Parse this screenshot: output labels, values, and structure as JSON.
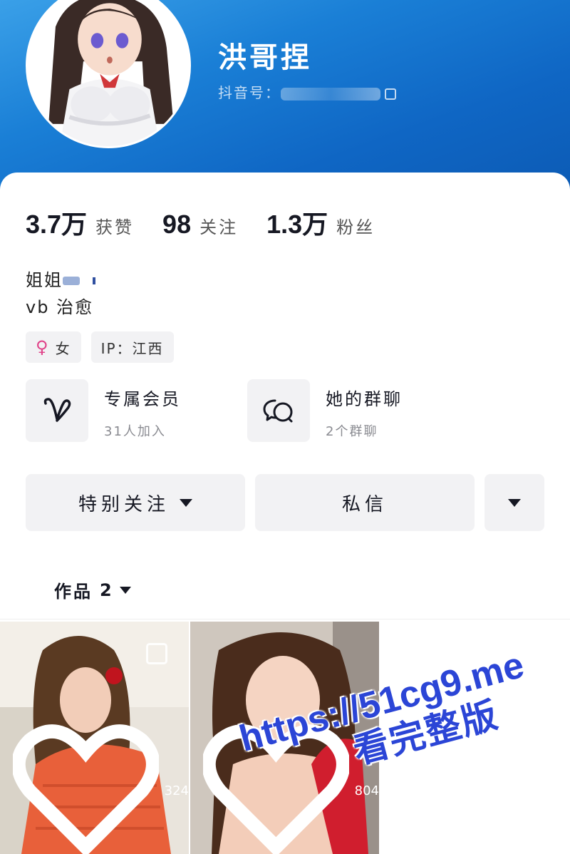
{
  "profile": {
    "nickname": "洪哥捏",
    "account_label": "抖音号：",
    "stats": [
      {
        "value": "3.7万",
        "label": "获赞"
      },
      {
        "value": "98",
        "label": "关注"
      },
      {
        "value": "1.3万",
        "label": "粉丝"
      }
    ],
    "bio_line1": "姐姐",
    "bio_line2": "vb 治愈",
    "tags": {
      "gender": "女",
      "ip": "IP：江西"
    }
  },
  "features": {
    "membership": {
      "title": "专属会员",
      "sub": "31人加入",
      "icon": "heart-v-icon"
    },
    "group_chat": {
      "title": "她的群聊",
      "sub": "2个群聊",
      "icon": "chat-bubbles-icon"
    }
  },
  "actions": {
    "follow_label": "特别关注",
    "message_label": "私信"
  },
  "works": {
    "tab_label": "作品",
    "count": "2",
    "items": [
      {
        "likes": "324"
      },
      {
        "likes": "804"
      }
    ]
  },
  "watermark": {
    "line1": "https://51cg9.me",
    "line2": "看完整版"
  },
  "colors": {
    "header_blue": "#0f66c4",
    "female_pink": "#e0448a",
    "watermark_blue": "#2b45d6"
  }
}
